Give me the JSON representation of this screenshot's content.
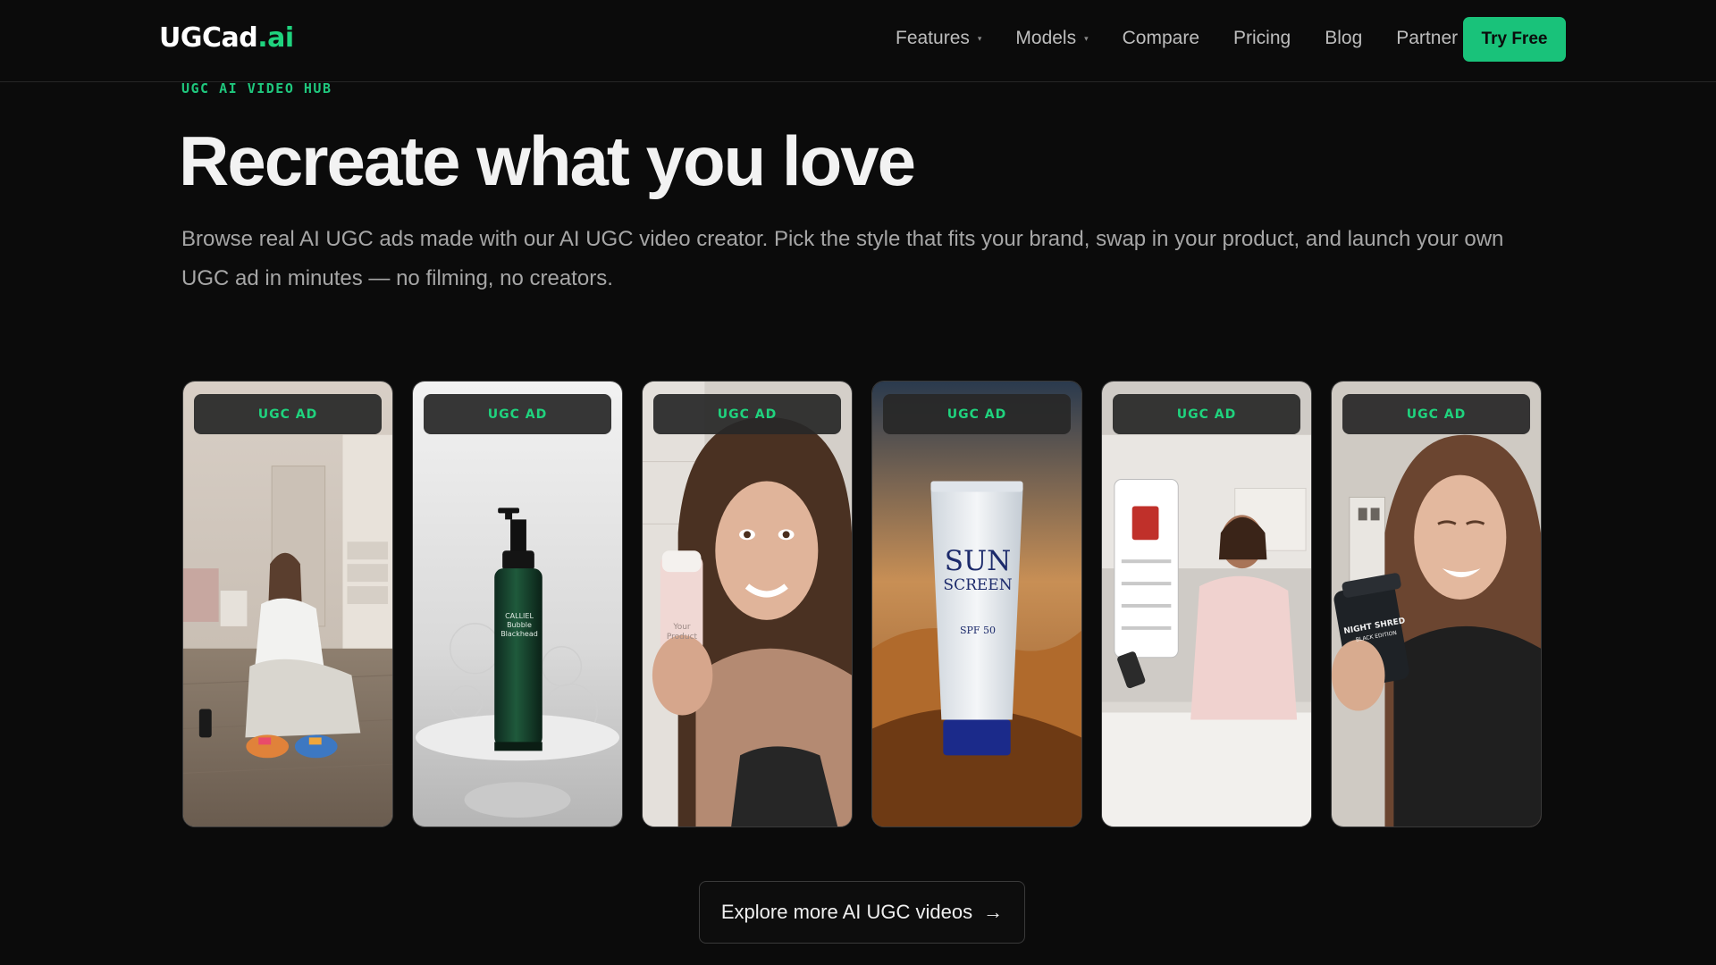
{
  "header": {
    "logo_main": "UGCad",
    "logo_accent": ".ai",
    "nav": [
      {
        "label": "Features",
        "has_dropdown": true
      },
      {
        "label": "Models",
        "has_dropdown": true
      },
      {
        "label": "Compare",
        "has_dropdown": false
      },
      {
        "label": "Pricing",
        "has_dropdown": false
      },
      {
        "label": "Blog",
        "has_dropdown": false
      },
      {
        "label": "Partner",
        "has_dropdown": false
      }
    ],
    "cta_label": "Try Free"
  },
  "hero": {
    "eyebrow": "UGC AI VIDEO HUB",
    "title": "Recreate what you love",
    "description": "Browse real AI UGC ads made with our AI UGC video creator. Pick the style that fits your brand, swap in your product, and launch your own UGC ad in minutes — no filming, no creators."
  },
  "cards": [
    {
      "badge": "UGC AD",
      "subject": "woman tying sneakers in bedroom"
    },
    {
      "badge": "UGC AD",
      "subject": "green pump bottle in foam",
      "product_lines": [
        "CALLIEL",
        "Bubble",
        "Blackhead"
      ]
    },
    {
      "badge": "UGC AD",
      "subject": "woman holding pink bottle",
      "product_lines": [
        "Your",
        "Product"
      ]
    },
    {
      "badge": "UGC AD",
      "subject": "sunscreen tube on sand",
      "product_lines": [
        "SUN",
        "SCREEN",
        "SPF 50"
      ]
    },
    {
      "badge": "UGC AD",
      "subject": "woman with phone in kitchen"
    },
    {
      "badge": "UGC AD",
      "subject": "woman holding supplement jar",
      "product_lines": [
        "NIGHT SHRED",
        "BLACK EDITION"
      ]
    }
  ],
  "explore": {
    "label": "Explore more AI UGC videos",
    "arrow": "→"
  },
  "colors": {
    "background": "#0b0b0b",
    "accent": "#19c27a",
    "eyebrow": "#1fc77d"
  }
}
